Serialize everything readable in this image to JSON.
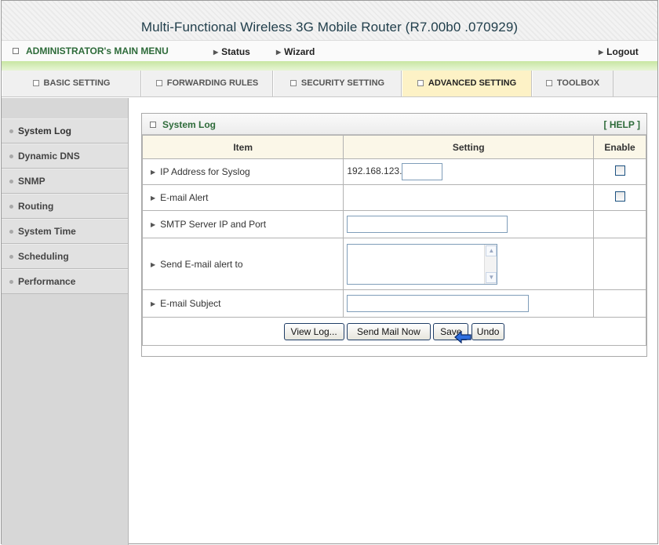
{
  "banner": {
    "title": "Multi-Functional Wireless 3G Mobile Router (R7.00b0 .070929)"
  },
  "menubar": {
    "admin_label": "ADMINISTRATOR's MAIN MENU",
    "status": "Status",
    "wizard": "Wizard",
    "logout": "Logout"
  },
  "tabs": [
    {
      "label": "BASIC SETTING"
    },
    {
      "label": "FORWARDING RULES"
    },
    {
      "label": "SECURITY SETTING"
    },
    {
      "label": "ADVANCED SETTING",
      "active": true
    },
    {
      "label": "TOOLBOX"
    }
  ],
  "sidebar": {
    "items": [
      {
        "label": "System Log"
      },
      {
        "label": "Dynamic DNS"
      },
      {
        "label": "SNMP"
      },
      {
        "label": "Routing"
      },
      {
        "label": "System Time"
      },
      {
        "label": "Scheduling"
      },
      {
        "label": "Performance"
      }
    ]
  },
  "panel": {
    "title": "System Log",
    "help": "[ HELP ]",
    "columns": {
      "item": "Item",
      "setting": "Setting",
      "enable": "Enable"
    },
    "rows": {
      "syslog": {
        "label": "IP Address for Syslog",
        "prefix": "192.168.123.",
        "value": "",
        "enabled": false
      },
      "email_alert": {
        "label": "E-mail Alert",
        "enabled": false
      },
      "smtp": {
        "label": "SMTP Server IP and Port",
        "value": ""
      },
      "send_to": {
        "label": "Send E-mail alert to",
        "value": ""
      },
      "subject": {
        "label": "E-mail Subject",
        "value": ""
      }
    },
    "buttons": {
      "view_log": "View Log...",
      "send_mail": "Send Mail Now",
      "save": "Save",
      "undo": "Undo"
    }
  },
  "colors": {
    "menu_green": "#2e6b3a",
    "active_tab": "#fdf2c6",
    "sidebar_bg": "#d7d7d7",
    "header_row": "#fbf7e8"
  }
}
